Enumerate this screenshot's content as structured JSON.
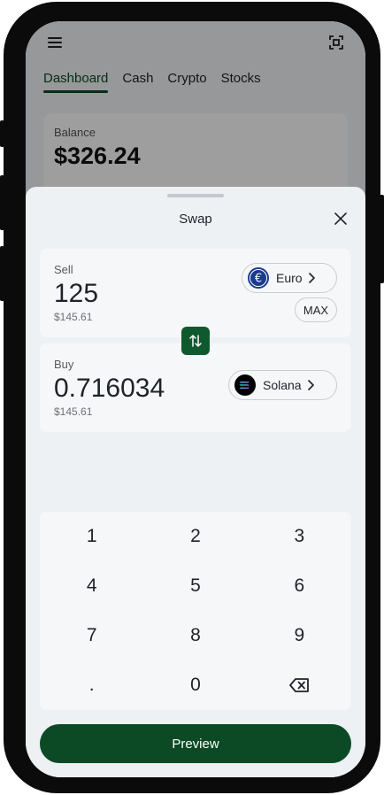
{
  "app": {
    "tabs": [
      {
        "label": "Dashboard",
        "active": true
      },
      {
        "label": "Cash",
        "active": false
      },
      {
        "label": "Crypto",
        "active": false
      },
      {
        "label": "Stocks",
        "active": false
      }
    ],
    "balance": {
      "label": "Balance",
      "value": "$326.24"
    },
    "icons": {
      "menu": "hamburger-menu-icon",
      "scan": "scan-frame-icon"
    }
  },
  "sheet": {
    "title": "Swap",
    "sell": {
      "label": "Sell",
      "amount": "125",
      "fiat_value": "$145.61",
      "asset": "Euro",
      "max_label": "MAX"
    },
    "buy": {
      "label": "Buy",
      "amount": "0.716034",
      "fiat_value": "$145.61",
      "asset": "Solana"
    },
    "keypad": [
      "1",
      "2",
      "3",
      "4",
      "5",
      "6",
      "7",
      "8",
      "9",
      ".",
      "0",
      "⌫"
    ],
    "preview_label": "Preview"
  },
  "colors": {
    "brand_green": "#0b4a24",
    "swap_green": "#0e5a2e",
    "euro_blue": "#1a3a8c"
  }
}
